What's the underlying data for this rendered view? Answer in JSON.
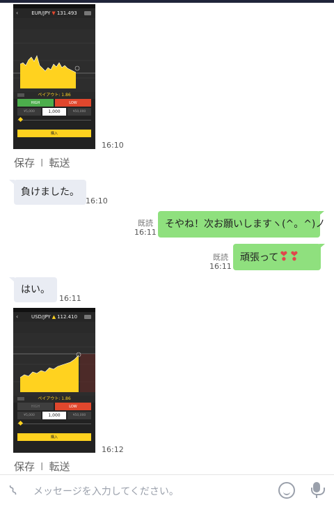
{
  "messages": {
    "shot1": {
      "pair": "EUR/JPY",
      "price": "131.493",
      "payout": "ペイアウト: 1.86",
      "high_label": "HIGH",
      "low_label": "LOW",
      "amount_min": "¥5,000",
      "amount": "1,000",
      "amount_max": "¥50,000",
      "buy_label": "購入",
      "time": "16:10"
    },
    "shot1_actions": {
      "save": "保存",
      "forward": "転送"
    },
    "msg1": {
      "text": "負けました。",
      "time": "16:10"
    },
    "msg2": {
      "text": "そやね！次お願いしますヽ(^。^)ノ",
      "read": "既読",
      "time": "16:11"
    },
    "msg3": {
      "text": "頑張って",
      "read": "既読",
      "time": "16:11"
    },
    "msg4": {
      "text": "はい。",
      "time": "16:11"
    },
    "shot2": {
      "pair": "USD/JPY",
      "price": "112.410",
      "payout": "ペイアウト: 1.86",
      "high_label": "HIGH",
      "low_label": "LOW",
      "amount_min": "¥5,000",
      "amount": "1,000",
      "amount_max": "¥50,000",
      "buy_label": "購入",
      "time": "16:12"
    },
    "shot2_actions": {
      "save": "保存",
      "forward": "転送"
    }
  },
  "input": {
    "placeholder": "メッセージを入力してください。"
  },
  "icons": {
    "attach": "paperclip-icon",
    "emoji": "smiley-icon",
    "voice": "microphone-icon",
    "heart": "heart-icon"
  },
  "colors": {
    "sent_bubble": "#8fe07e",
    "received_bubble": "#e9ecf3",
    "chart_fill": "#ffd21f",
    "high_button": "#4cae4c",
    "low_button": "#e0472d"
  }
}
